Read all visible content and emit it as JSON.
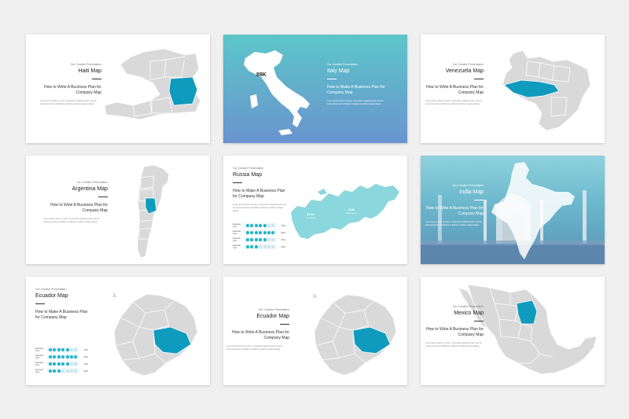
{
  "colors": {
    "page_bg": "#f0f0f0",
    "highlight": "#0e9bbd",
    "land": "#d9d9d9",
    "accent": "#1fb3c4"
  },
  "common": {
    "kicker": "Our Creative Presentation",
    "body": "Lorem ipsum dolor sit amet, consectetur adipiscing elit, sed do eiusmod tempor incididunt ut labore et dolore magna aliqua."
  },
  "slides": {
    "haiti": {
      "title": "Haiti Map",
      "subtitle": "How to Write A Business Plan for Company Map"
    },
    "italy": {
      "title": "Italy Map",
      "subtitle": "How to Make A Business Plan for Company Map",
      "badge": "89K"
    },
    "venezuela": {
      "title": "Venezuela Map",
      "subtitle": "How to Write A Business Plan for Company Map"
    },
    "argentina": {
      "title": "Argentina Map",
      "subtitle": "How to Write A Business Plan for Company Map"
    },
    "russia": {
      "title": "Russia Map",
      "subtitle": "How to Make A Business Plan for Company Map",
      "stats": [
        {
          "value": "23.11",
          "label": "Lorem ipsum"
        },
        {
          "value": "5.36",
          "label": "Lorem ipsum"
        }
      ],
      "bars": [
        {
          "label": "Example here",
          "percent": "70%",
          "filled": 5
        },
        {
          "label": "Example here",
          "percent": "90%",
          "filled": 7
        },
        {
          "label": "Example here",
          "percent": "75%",
          "filled": 5
        },
        {
          "label": "Example here",
          "percent": "40%",
          "filled": 3
        }
      ]
    },
    "india": {
      "title": "India Map",
      "subtitle": "How to Write A Business Plan for Company Map"
    },
    "ecuador1": {
      "title": "Ecuador Map",
      "subtitle": "How to Make A Business Plan for Company Map",
      "bars": [
        {
          "label": "Example here",
          "percent": "70%",
          "filled": 5
        },
        {
          "label": "Example here",
          "percent": "90%",
          "filled": 7
        },
        {
          "label": "Example here",
          "percent": "75%",
          "filled": 5
        },
        {
          "label": "Example here",
          "percent": "40%",
          "filled": 3
        }
      ]
    },
    "ecuador2": {
      "title": "Ecuador Map",
      "subtitle": "How to Write A Business Plan for Company Map"
    },
    "mexico": {
      "title": "Mexico Map",
      "subtitle": "How to Write A Business Plan for Company Map"
    }
  }
}
